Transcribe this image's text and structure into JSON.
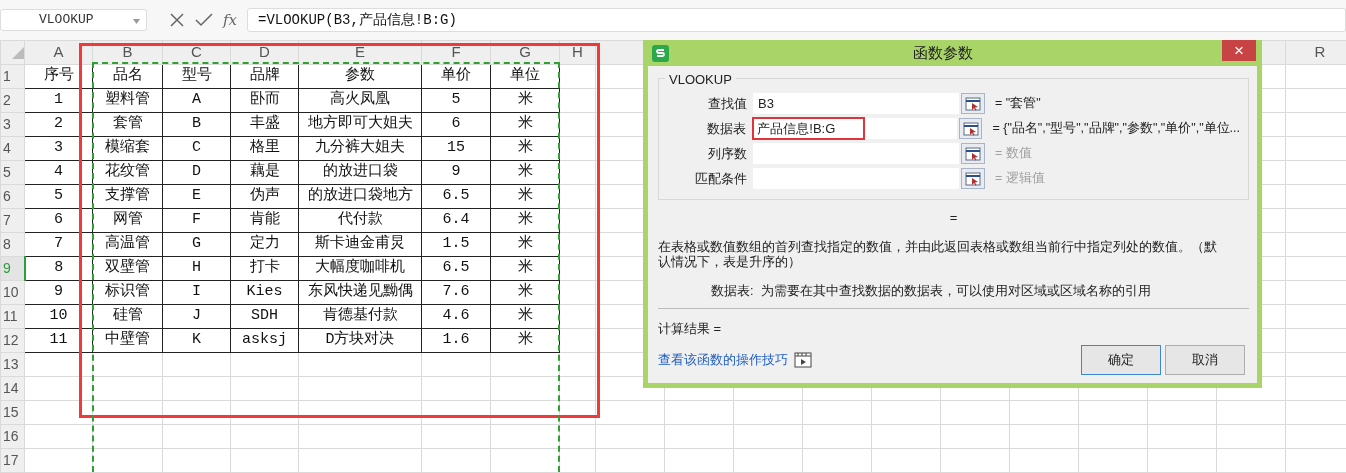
{
  "name_box": {
    "value": "VLOOKUP"
  },
  "formula_bar": {
    "fx": "fx",
    "formula": "=VLOOKUP(B3,产品信息!B:G)"
  },
  "sheet": {
    "columns": [
      "A",
      "B",
      "C",
      "D",
      "E",
      "F",
      "G",
      "H",
      "R"
    ],
    "row_headers": [
      {
        "label": "1",
        "selected": false
      },
      {
        "label": "2",
        "selected": false
      },
      {
        "label": "3",
        "selected": false
      },
      {
        "label": "4",
        "selected": false
      },
      {
        "label": "5",
        "selected": false
      },
      {
        "label": "6",
        "selected": false
      },
      {
        "label": "7",
        "selected": false
      },
      {
        "label": "8",
        "selected": false
      },
      {
        "label": "9",
        "selected": true
      },
      {
        "label": "10",
        "selected": false
      },
      {
        "label": "11",
        "selected": false
      },
      {
        "label": "12",
        "selected": false
      },
      {
        "label": "13",
        "selected": false
      },
      {
        "label": "14",
        "selected": false
      },
      {
        "label": "15",
        "selected": false
      },
      {
        "label": "16",
        "selected": false
      },
      {
        "label": "17",
        "selected": false
      }
    ],
    "rows": [
      [
        "序号",
        "品名",
        "型号",
        "品牌",
        "参数",
        "单价",
        "单位"
      ],
      [
        "1",
        "塑料管",
        "A",
        "卧而",
        "高火凤凰",
        "5",
        "米"
      ],
      [
        "2",
        "套管",
        "B",
        "丰盛",
        "地方即可大姐夫",
        "6",
        "米"
      ],
      [
        "3",
        "模缩套",
        "C",
        "格里",
        "九分裤大姐夫",
        "15",
        "米"
      ],
      [
        "4",
        "花纹管",
        "D",
        "藕是",
        "的放进口袋",
        "9",
        "米"
      ],
      [
        "5",
        "支撑管",
        "E",
        "伪声",
        "的放进口袋地方",
        "6.5",
        "米"
      ],
      [
        "6",
        "网管",
        "F",
        "肯能",
        "代付款",
        "6.4",
        "米"
      ],
      [
        "7",
        "高温管",
        "G",
        "定力",
        "斯卡迪金甫炅",
        "1.5",
        "米"
      ],
      [
        "8",
        "双壁管",
        "H",
        "打卡",
        "大幅度咖啡机",
        "6.5",
        "米"
      ],
      [
        "9",
        "标识管",
        "I",
        "Kies",
        "东风快递见黝偶",
        "7.6",
        "米"
      ],
      [
        "10",
        "硅管",
        "J",
        "SDH",
        "肯德基付款",
        "4.6",
        "米"
      ],
      [
        "11",
        "中壁管",
        "K",
        "asksj",
        "D方块对决",
        "1.6",
        "米"
      ]
    ]
  },
  "dialog": {
    "title": "函数参数",
    "close": "×",
    "group_title": "VLOOKUP",
    "params": [
      {
        "label": "查找值",
        "value": "B3",
        "result": "= \"套管\"",
        "muted": false,
        "highlighted": false
      },
      {
        "label": "数据表",
        "value": "产品信息!B:G",
        "result": "= {\"品名\",\"型号\",\"品牌\",\"参数\",\"单价\",\"单位...",
        "muted": false,
        "highlighted": true
      },
      {
        "label": "列序数",
        "result": "= 数值",
        "muted": true,
        "highlighted": false
      },
      {
        "label": "匹配条件",
        "result": "= 逻辑值",
        "muted": true,
        "highlighted": false
      }
    ],
    "formula_result": "=",
    "description": "在表格或数值数组的首列查找指定的数值，并由此返回表格或数组当前行中指定列处的数值。（默认情况下，表是升序的）",
    "param_help": {
      "label": "数据表:",
      "text": "为需要在其中查找数据的数据表，可以使用对区域或区域名称的引用"
    },
    "calc_result": "计算结果 =",
    "help_link": "查看该函数的操作技巧",
    "buttons": [
      {
        "label": "确定",
        "default": true
      },
      {
        "label": "取消",
        "default": false
      }
    ]
  }
}
